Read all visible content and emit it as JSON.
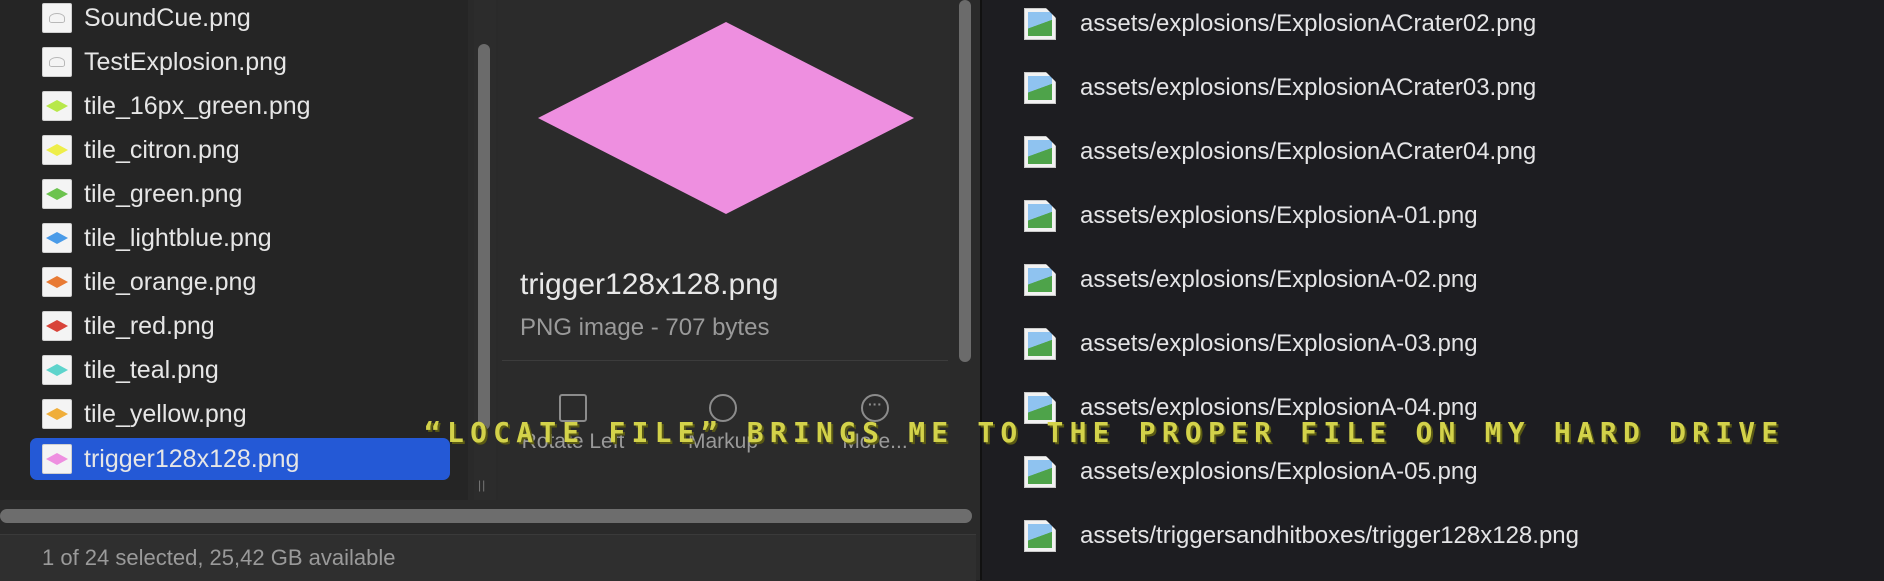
{
  "finder": {
    "files": [
      {
        "name": "SoundCue.png",
        "thumb": "scribble"
      },
      {
        "name": "TestExplosion.png",
        "thumb": "scribble"
      },
      {
        "name": "tile_16px_green.png",
        "thumb": "#b8e84a"
      },
      {
        "name": "tile_citron.png",
        "thumb": "#eeee4a"
      },
      {
        "name": "tile_green.png",
        "thumb": "#6cc34e"
      },
      {
        "name": "tile_lightblue.png",
        "thumb": "#4a9be8"
      },
      {
        "name": "tile_orange.png",
        "thumb": "#e87a34"
      },
      {
        "name": "tile_red.png",
        "thumb": "#d8443a"
      },
      {
        "name": "tile_teal.png",
        "thumb": "#5ed4cc"
      },
      {
        "name": "tile_yellow.png",
        "thumb": "#f0ae3a"
      },
      {
        "name": "trigger128x128.png",
        "thumb": "#ee8fe0",
        "selected": true
      }
    ],
    "preview": {
      "color": "#ee8fe0",
      "title": "trigger128x128.png",
      "info": "PNG image - 707 bytes",
      "actions": [
        {
          "label": "Rotate Left",
          "icon": "rotate-left-icon"
        },
        {
          "label": "Markup",
          "icon": "markup-icon"
        },
        {
          "label": "More...",
          "icon": "more-icon",
          "glyph": "···"
        }
      ]
    },
    "status": "1 of 24 selected, 25,42 GB available"
  },
  "assets": [
    "assets/explosions/ExplosionACrater02.png",
    "assets/explosions/ExplosionACrater03.png",
    "assets/explosions/ExplosionACrater04.png",
    "assets/explosions/ExplosionA-01.png",
    "assets/explosions/ExplosionA-02.png",
    "assets/explosions/ExplosionA-03.png",
    "assets/explosions/ExplosionA-04.png",
    "assets/explosions/ExplosionA-05.png",
    "assets/triggersandhitboxes/trigger128x128.png"
  ],
  "caption": "“Locate file” brings me to the proper file on my hard drive",
  "colors": {
    "selection": "#2459d6",
    "caption": "#d3d24a"
  }
}
